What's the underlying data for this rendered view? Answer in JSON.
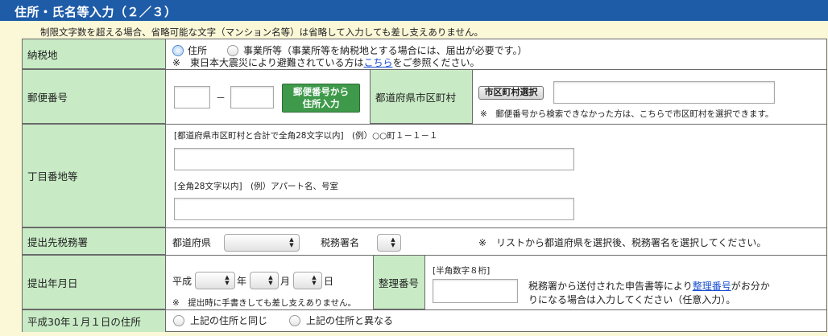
{
  "header": {
    "title": "住所・氏名等入力（２／３）"
  },
  "top_note": "制限文字数を超える場合、省略可能な文字（マンション名等）は省略して入力しても差し支えありません。",
  "rows": {
    "nozeichi": {
      "label": "納税地",
      "option_address": "住所",
      "option_office": "事業所等（事業所等を納税地とする場合には、届出が必要です。）",
      "note_prefix": "※　東日本大震災により避難されている方は",
      "note_link": "こちら",
      "note_suffix": "をご参照ください。",
      "selected": "住所"
    },
    "postal": {
      "label": "郵便番号",
      "dash": "－",
      "zip_first": "",
      "zip_second": "",
      "button_line1": "郵便番号から",
      "button_line2": "住所入力",
      "pref_label": "都道府県市区町村",
      "city_button": "市区町村選択",
      "city_value": "",
      "note": "※　郵便番号から検索できなかった方は、こちらで市区町村を選択できます。"
    },
    "chome": {
      "label": "丁目番地等",
      "hint1": "[都道府県市区町村と合計で全角28文字以内]　(例）○○町１－１－１",
      "value1": "",
      "hint2": "[全角28文字以内]　(例）アパート名、号室",
      "value2": ""
    },
    "office": {
      "label": "提出先税務署",
      "pref_label": "都道府県",
      "office_label": "税務署名",
      "note": "※　リストから都道府県を選択後、税務署名を選択してください。"
    },
    "date": {
      "label": "提出年月日",
      "era": "平成",
      "year_unit": "年",
      "month_unit": "月",
      "day_unit": "日",
      "note": "※　提出時に手書きしても差し支えありません。",
      "seiri_label": "整理番号",
      "seiri_hint": "[半角数字８桁]",
      "seiri_value": "",
      "seiri_note_prefix": "税務署から送付された申告書等により",
      "seiri_link": "整理番号",
      "seiri_note_mid": "がお分か",
      "seiri_note_line2": "りになる場合は入力してください（任意入力）。"
    },
    "h30": {
      "label": "平成30年１月１日の住所",
      "option_same": "上記の住所と同じ",
      "option_diff": "上記の住所と異なる"
    }
  },
  "colors": {
    "title_bar": "#1f5ca8",
    "page_bg": "#fbf8d8",
    "label_bg": "#c8ebc5",
    "button_green": "#3e9a4a",
    "link": "#1a4fd0"
  }
}
